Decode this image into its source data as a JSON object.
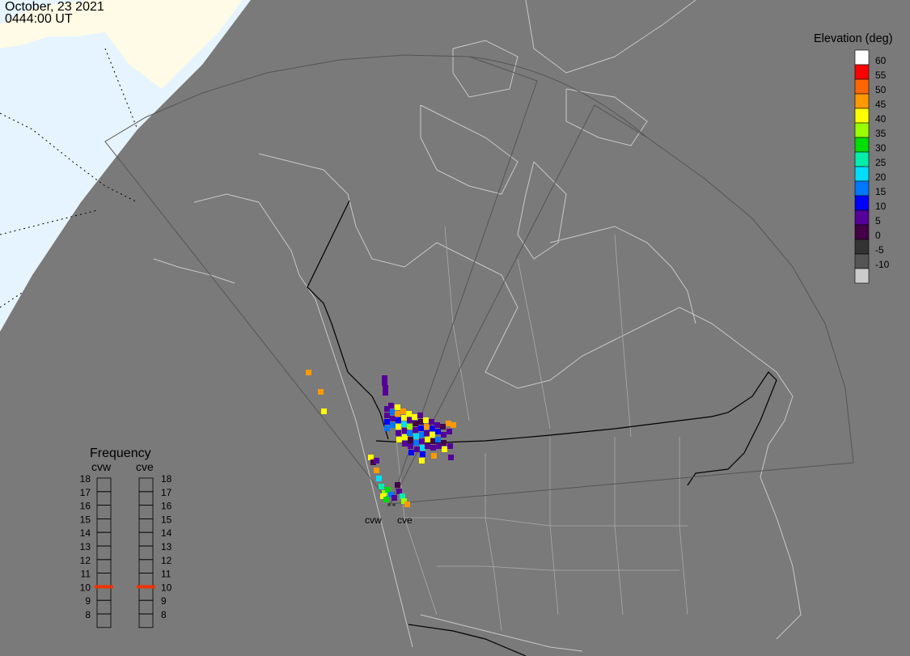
{
  "timestamp": {
    "date": "October, 23 2021",
    "time": "0444:00 UT"
  },
  "elevation_legend": {
    "title": "Elevation (deg)",
    "levels": [
      {
        "label": "60",
        "color": "#ffffff"
      },
      {
        "label": "55",
        "color": "#ff0000"
      },
      {
        "label": "50",
        "color": "#ff6600"
      },
      {
        "label": "45",
        "color": "#ff9900"
      },
      {
        "label": "40",
        "color": "#ffff00"
      },
      {
        "label": "35",
        "color": "#99ff00"
      },
      {
        "label": "30",
        "color": "#00dd00"
      },
      {
        "label": "25",
        "color": "#00eeaa"
      },
      {
        "label": "20",
        "color": "#00ddff"
      },
      {
        "label": "15",
        "color": "#0077ff"
      },
      {
        "label": "10",
        "color": "#0000ff"
      },
      {
        "label": "5",
        "color": "#550099"
      },
      {
        "label": "0",
        "color": "#440044"
      },
      {
        "label": "-5",
        "color": "#333333"
      },
      {
        "label": "-10",
        "color": "#555555"
      },
      {
        "label": "",
        "color": "#cccccc"
      }
    ]
  },
  "frequency_panel": {
    "title": "Frequency",
    "radars": [
      {
        "name": "cvw",
        "current_mhz": 10.5
      },
      {
        "name": "cve",
        "current_mhz": 10.5
      }
    ],
    "scale": [
      "18",
      "17",
      "16",
      "15",
      "14",
      "13",
      "12",
      "11",
      "10",
      "9",
      "8"
    ],
    "indicator_color": "#ee3300"
  },
  "site_labels": [
    "cvw",
    "cve"
  ],
  "colors": {
    "background": "#7a7a7a",
    "coast": "#c8c8c8",
    "border": "#000000",
    "fov": "#555555",
    "daylight_ocean": "#e6f4ff",
    "daylight_land": "#fffbe6"
  }
}
